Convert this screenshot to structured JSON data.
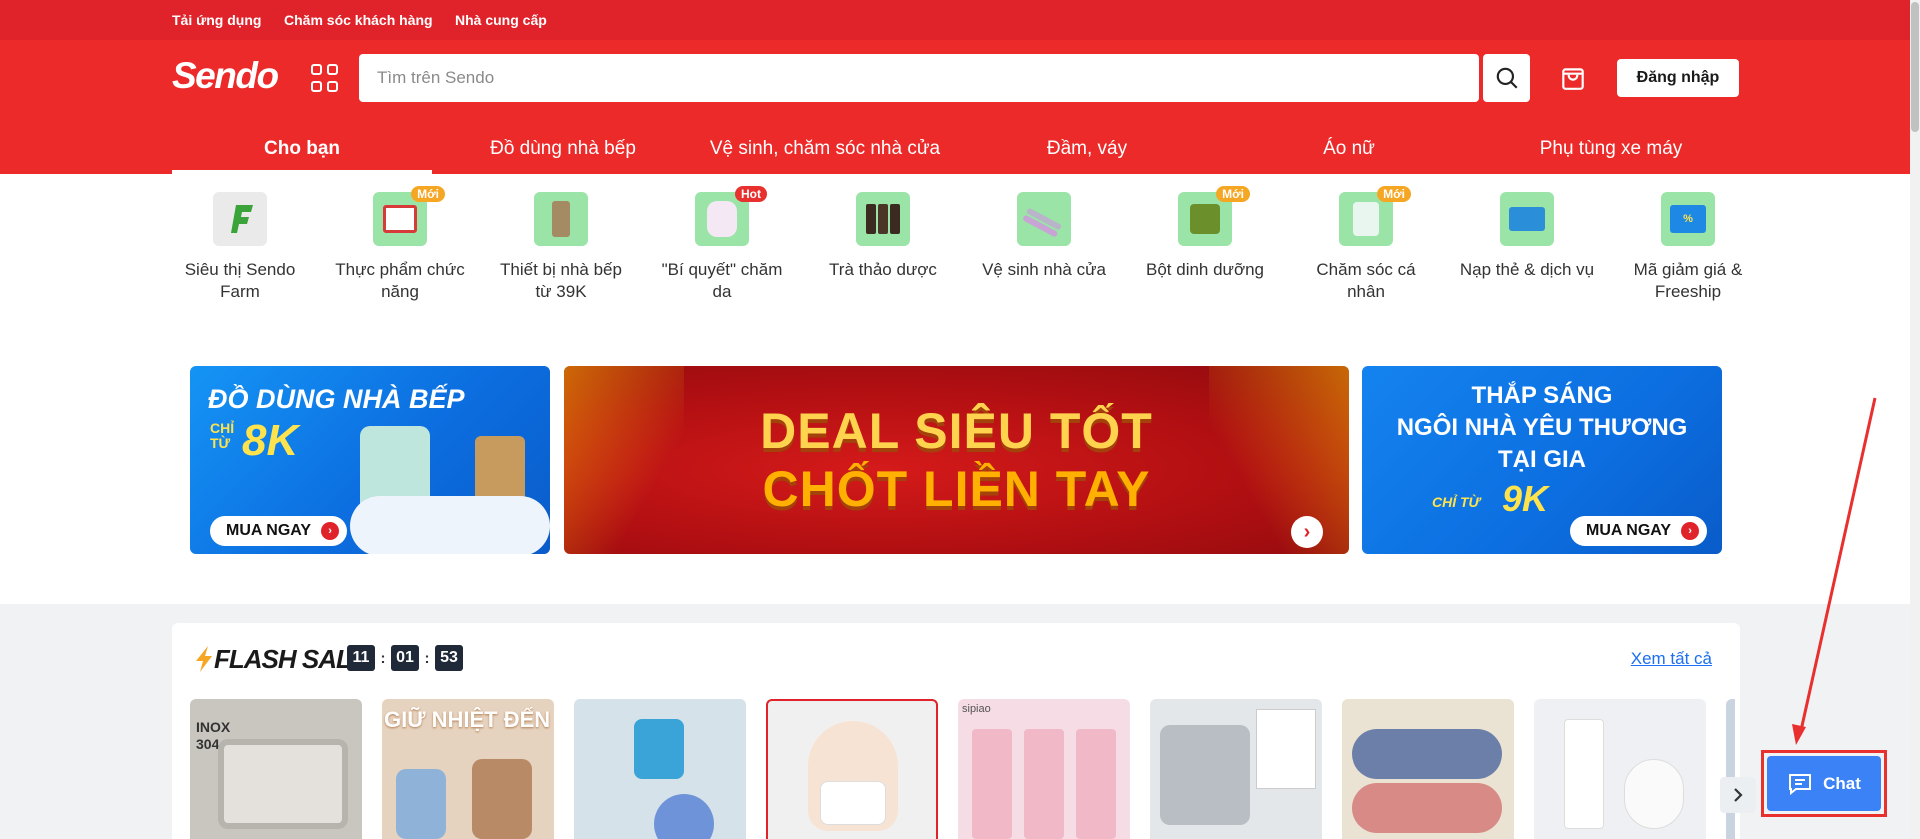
{
  "topbar": {
    "links": [
      "Tải ứng dụng",
      "Chăm sóc khách hàng",
      "Nhà cung cấp"
    ]
  },
  "header": {
    "logo": "Sendo",
    "search_placeholder": "Tìm trên Sendo",
    "login_label": "Đăng nhập"
  },
  "tabs": [
    "Cho bạn",
    "Đồ dùng nhà bếp",
    "Vệ sinh, chăm sóc nhà cửa",
    "Đầm, váy",
    "Áo nữ",
    "Phụ tùng xe máy"
  ],
  "quick_categories": [
    {
      "label": "Siêu thị Sendo Farm",
      "badge": ""
    },
    {
      "label": "Thực phẩm chức năng",
      "badge": "Mới"
    },
    {
      "label": "Thiết bị nhà bếp từ 39K",
      "badge": ""
    },
    {
      "label": "\"Bí quyết\" chăm da",
      "badge": "Hot"
    },
    {
      "label": "Trà thảo dược",
      "badge": ""
    },
    {
      "label": "Vệ sinh nhà cửa",
      "badge": ""
    },
    {
      "label": "Bột dinh dưỡng",
      "badge": "Mới"
    },
    {
      "label": "Chăm sóc cá nhân",
      "badge": "Mới"
    },
    {
      "label": "Nạp thẻ & dịch vụ",
      "badge": ""
    },
    {
      "label": "Mã giảm giá & Freeship",
      "badge": ""
    }
  ],
  "banners": {
    "left": {
      "line1": "ĐỒ DÙNG NHÀ BẾP",
      "chi": "CHỈ",
      "tu": "TỪ",
      "price": "8K",
      "cta": "MUA NGAY"
    },
    "mid": {
      "line1": "DEAL SIÊU TỐT",
      "line2": "CHỐT LIỀN TAY"
    },
    "right": {
      "line1": "THẮP SÁNG",
      "line2": "NGÔI NHÀ YÊU THƯƠNG",
      "line3": "TẠI GIA",
      "chi_tu": "CHỈ TỪ",
      "price": "9K",
      "cta": "MUA NGAY"
    }
  },
  "flash_sale": {
    "title": "FLASH SALE",
    "hours": "11",
    "minutes": "01",
    "seconds": "53",
    "sep": ":",
    "see_all": "Xem tất cả"
  },
  "products": [
    {
      "tag": "INOX 304",
      "bg": "#c9c6c0"
    },
    {
      "tag": "GIỮ NHIỆT ĐẾN",
      "bg": "#e6d3bf"
    },
    {
      "tag": "",
      "bg": "#d6e2ea"
    },
    {
      "tag": "",
      "bg": "#f0f0f0"
    },
    {
      "tag": "sipiao",
      "bg": "#f6dce4"
    },
    {
      "tag": "",
      "bg": "#e4e7ea"
    },
    {
      "tag": "",
      "bg": "#eae2d2"
    },
    {
      "tag": "",
      "bg": "#eef0f3"
    }
  ],
  "chat": {
    "label": "Chat"
  },
  "colors": {
    "brand_red": "#e0232b",
    "header_red": "#ec2a2a",
    "chat_blue": "#3b82f6",
    "link_blue": "#1b6ff0"
  }
}
